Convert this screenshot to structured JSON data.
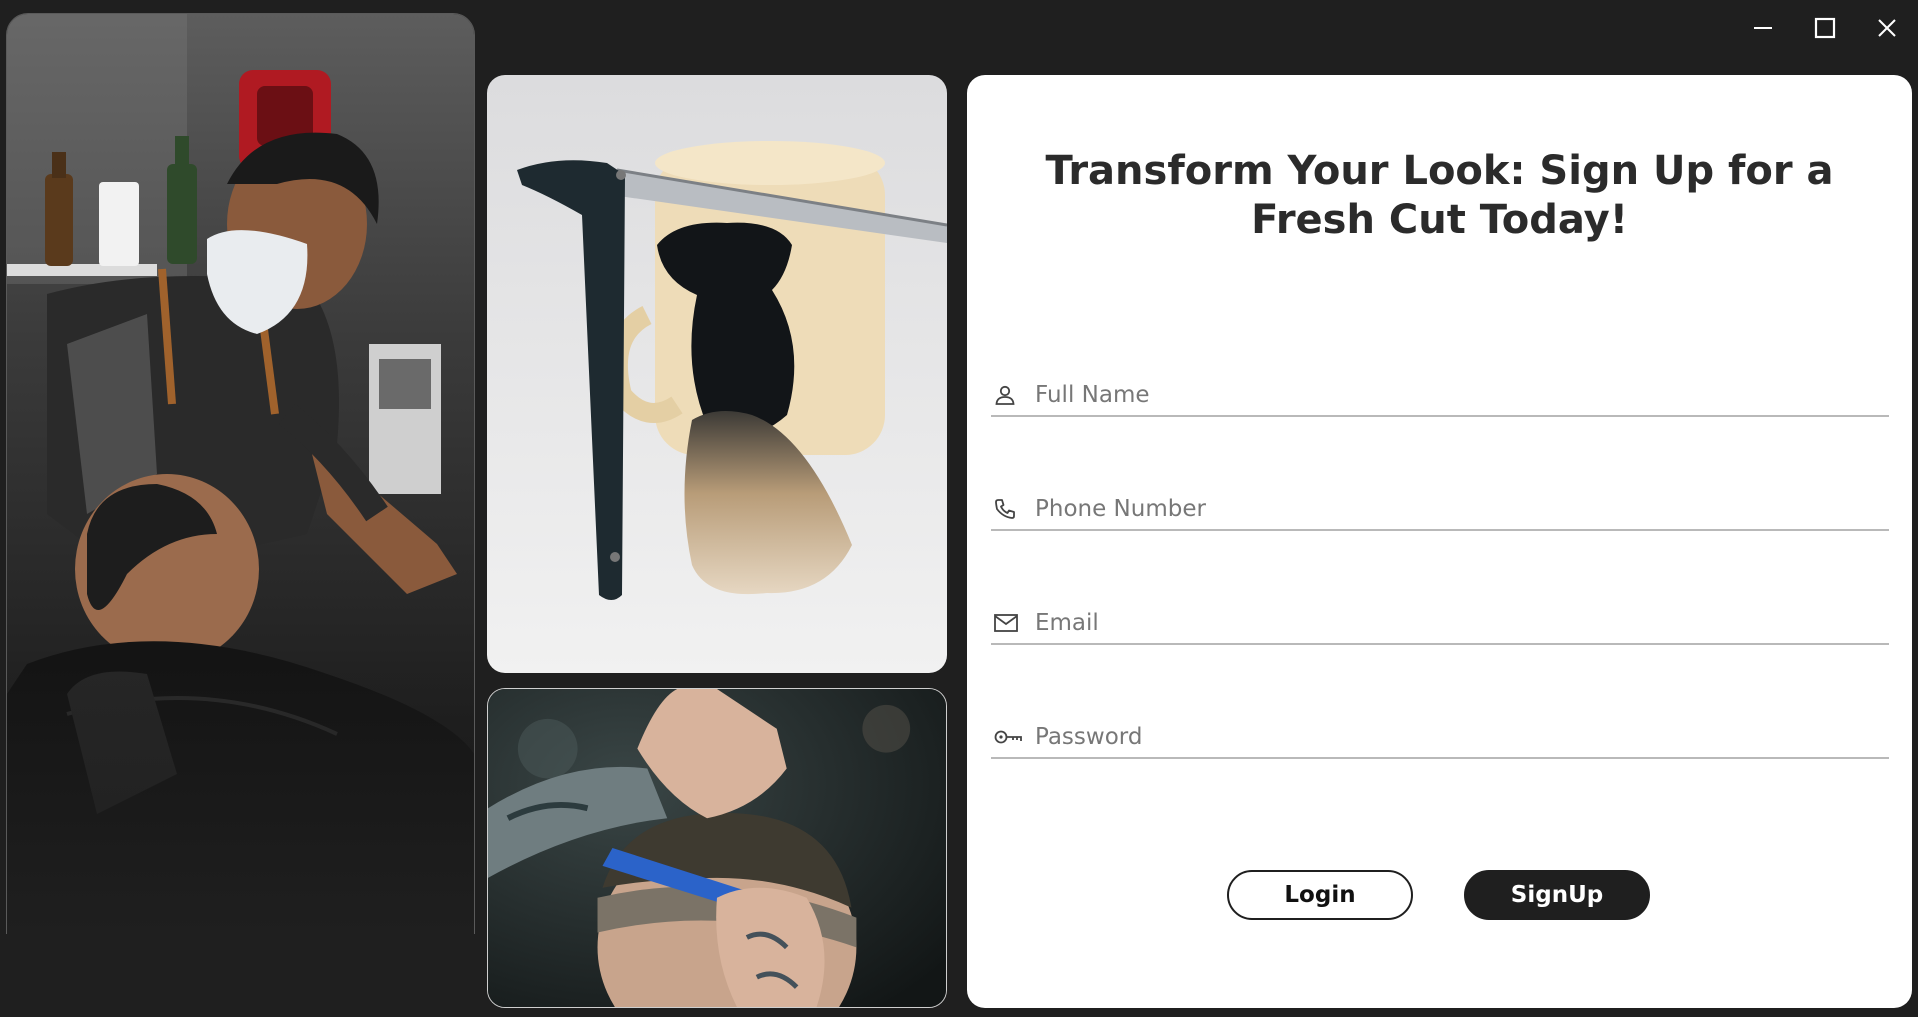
{
  "window": {
    "minimize_icon": "minimize-icon",
    "maximize_icon": "maximize-icon",
    "close_icon": "close-icon"
  },
  "gallery": {
    "images": [
      {
        "name": "barber-masked-client-photo"
      },
      {
        "name": "straight-razor-shaving-brush-photo"
      },
      {
        "name": "haircut-comb-photo"
      }
    ]
  },
  "form": {
    "title": "Transform Your Look: Sign Up for a Fresh Cut Today!",
    "fields": [
      {
        "icon": "user-icon",
        "placeholder": "Full Name",
        "value": ""
      },
      {
        "icon": "phone-icon",
        "placeholder": "Phone Number",
        "value": ""
      },
      {
        "icon": "mail-icon",
        "placeholder": "Email",
        "value": ""
      },
      {
        "icon": "key-icon",
        "placeholder": "Password",
        "value": ""
      }
    ],
    "login_label": "Login",
    "signup_label": "SignUp"
  },
  "colors": {
    "background": "#1f1f1f",
    "card": "#ffffff",
    "primary_button": "#1f1f1f"
  }
}
